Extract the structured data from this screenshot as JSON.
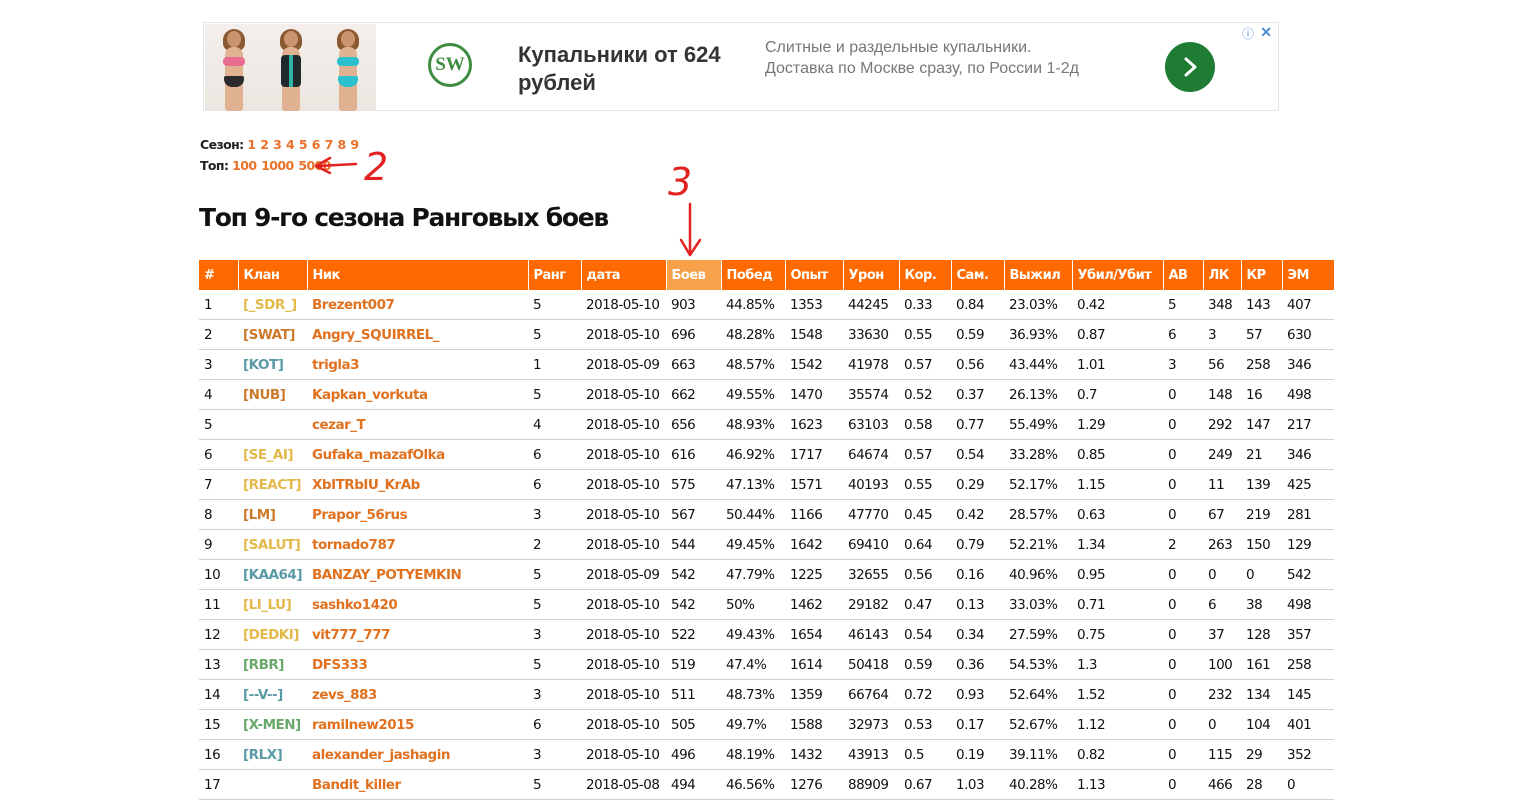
{
  "ad": {
    "title": "Купальники от 624 рублей",
    "description": "Слитные и раздельные купальники. Доставка по Москве сразу, по России 1-2д",
    "logo_text": "SW",
    "info_icon": "info-icon",
    "close_icon": "close-icon",
    "accent": "#1e7d32"
  },
  "nav": {
    "season_label": "Сезон:",
    "seasons": [
      "1",
      "2",
      "3",
      "4",
      "5",
      "6",
      "7",
      "8",
      "9"
    ],
    "top_label": "Топ:",
    "tops": [
      "100",
      "1000",
      "5000"
    ]
  },
  "annotations": [
    "2",
    "3"
  ],
  "page_title": "Топ 9-го сезона Ранговых боев",
  "table": {
    "header_color": "#ff6a00",
    "active_header_color": "#f7a24b",
    "active_column": "Боев",
    "columns": [
      "#",
      "Клан",
      "Ник",
      "Ранг",
      "дата",
      "Боев",
      "Побед",
      "Опыт",
      "Урон",
      "Кор.",
      "Сам.",
      "Выжил",
      "Убил/Убит",
      "АВ",
      "ЛК",
      "КР",
      "ЭМ"
    ],
    "rows": [
      {
        "num": "1",
        "clan": "[_SDR_]",
        "clan_color": "#e3b94a",
        "nick": "Brezent007",
        "rank": "5",
        "date": "2018-05-10",
        "battles": "903",
        "wins": "44.85%",
        "xp": "1353",
        "dmg": "44245",
        "kor": "0.33",
        "sam": "0.84",
        "surv": "23.03%",
        "kd": "0.42",
        "av": "5",
        "lk": "348",
        "kr": "143",
        "em": "407"
      },
      {
        "num": "2",
        "clan": "[SWAT]",
        "clan_color": "#cc7a2a",
        "nick": "Angry_SQUIRREL_",
        "rank": "5",
        "date": "2018-05-10",
        "battles": "696",
        "wins": "48.28%",
        "xp": "1548",
        "dmg": "33630",
        "kor": "0.55",
        "sam": "0.59",
        "surv": "36.93%",
        "kd": "0.87",
        "av": "6",
        "lk": "3",
        "kr": "57",
        "em": "630"
      },
      {
        "num": "3",
        "clan": "[KOT]",
        "clan_color": "#5a9aa6",
        "nick": "trigla3",
        "rank": "1",
        "date": "2018-05-09",
        "battles": "663",
        "wins": "48.57%",
        "xp": "1542",
        "dmg": "41978",
        "kor": "0.57",
        "sam": "0.56",
        "surv": "43.44%",
        "kd": "1.01",
        "av": "3",
        "lk": "56",
        "kr": "258",
        "em": "346"
      },
      {
        "num": "4",
        "clan": "[NUB]",
        "clan_color": "#cc7a2a",
        "nick": "Kapkan_vorkuta",
        "rank": "5",
        "date": "2018-05-10",
        "battles": "662",
        "wins": "49.55%",
        "xp": "1470",
        "dmg": "35574",
        "kor": "0.52",
        "sam": "0.37",
        "surv": "26.13%",
        "kd": "0.7",
        "av": "0",
        "lk": "148",
        "kr": "16",
        "em": "498"
      },
      {
        "num": "5",
        "clan": "",
        "clan_color": "#cc7a2a",
        "nick": "cezar_T",
        "rank": "4",
        "date": "2018-05-10",
        "battles": "656",
        "wins": "48.93%",
        "xp": "1623",
        "dmg": "63103",
        "kor": "0.58",
        "sam": "0.77",
        "surv": "55.49%",
        "kd": "1.29",
        "av": "0",
        "lk": "292",
        "kr": "147",
        "em": "217"
      },
      {
        "num": "6",
        "clan": "[SE_AI]",
        "clan_color": "#e3b94a",
        "nick": "Gufaka_mazafOlka",
        "rank": "6",
        "date": "2018-05-10",
        "battles": "616",
        "wins": "46.92%",
        "xp": "1717",
        "dmg": "64674",
        "kor": "0.57",
        "sam": "0.54",
        "surv": "33.28%",
        "kd": "0.85",
        "av": "0",
        "lk": "249",
        "kr": "21",
        "em": "346"
      },
      {
        "num": "7",
        "clan": "[REACT]",
        "clan_color": "#e3b94a",
        "nick": "XbITRbIU_KrAb",
        "rank": "6",
        "date": "2018-05-10",
        "battles": "575",
        "wins": "47.13%",
        "xp": "1571",
        "dmg": "40193",
        "kor": "0.55",
        "sam": "0.29",
        "surv": "52.17%",
        "kd": "1.15",
        "av": "0",
        "lk": "11",
        "kr": "139",
        "em": "425"
      },
      {
        "num": "8",
        "clan": "[LM]",
        "clan_color": "#cc7a2a",
        "nick": "Prapor_56rus",
        "rank": "3",
        "date": "2018-05-10",
        "battles": "567",
        "wins": "50.44%",
        "xp": "1166",
        "dmg": "47770",
        "kor": "0.45",
        "sam": "0.42",
        "surv": "28.57%",
        "kd": "0.63",
        "av": "0",
        "lk": "67",
        "kr": "219",
        "em": "281"
      },
      {
        "num": "9",
        "clan": "[SALUT]",
        "clan_color": "#e3b94a",
        "nick": "tornado787",
        "rank": "2",
        "date": "2018-05-10",
        "battles": "544",
        "wins": "49.45%",
        "xp": "1642",
        "dmg": "69410",
        "kor": "0.64",
        "sam": "0.79",
        "surv": "52.21%",
        "kd": "1.34",
        "av": "2",
        "lk": "263",
        "kr": "150",
        "em": "129"
      },
      {
        "num": "10",
        "clan": "[KAA64]",
        "clan_color": "#5a9aa6",
        "nick": "BANZAY_POTYEMKIN",
        "rank": "5",
        "date": "2018-05-09",
        "battles": "542",
        "wins": "47.79%",
        "xp": "1225",
        "dmg": "32655",
        "kor": "0.56",
        "sam": "0.16",
        "surv": "40.96%",
        "kd": "0.95",
        "av": "0",
        "lk": "0",
        "kr": "0",
        "em": "542"
      },
      {
        "num": "11",
        "clan": "[LI_LU]",
        "clan_color": "#e3b94a",
        "nick": "sashko1420",
        "rank": "5",
        "date": "2018-05-10",
        "battles": "542",
        "wins": "50%",
        "xp": "1462",
        "dmg": "29182",
        "kor": "0.47",
        "sam": "0.13",
        "surv": "33.03%",
        "kd": "0.71",
        "av": "0",
        "lk": "6",
        "kr": "38",
        "em": "498"
      },
      {
        "num": "12",
        "clan": "[DEDKI]",
        "clan_color": "#e3b94a",
        "nick": "vit777_777",
        "rank": "3",
        "date": "2018-05-10",
        "battles": "522",
        "wins": "49.43%",
        "xp": "1654",
        "dmg": "46143",
        "kor": "0.54",
        "sam": "0.34",
        "surv": "27.59%",
        "kd": "0.75",
        "av": "0",
        "lk": "37",
        "kr": "128",
        "em": "357"
      },
      {
        "num": "13",
        "clan": "[RBR]",
        "clan_color": "#6aa86a",
        "nick": "DFS333",
        "rank": "5",
        "date": "2018-05-10",
        "battles": "519",
        "wins": "47.4%",
        "xp": "1614",
        "dmg": "50418",
        "kor": "0.59",
        "sam": "0.36",
        "surv": "54.53%",
        "kd": "1.3",
        "av": "0",
        "lk": "100",
        "kr": "161",
        "em": "258"
      },
      {
        "num": "14",
        "clan": "[--V--]",
        "clan_color": "#5a9aa6",
        "nick": "zevs_883",
        "rank": "3",
        "date": "2018-05-10",
        "battles": "511",
        "wins": "48.73%",
        "xp": "1359",
        "dmg": "66764",
        "kor": "0.72",
        "sam": "0.93",
        "surv": "52.64%",
        "kd": "1.52",
        "av": "0",
        "lk": "232",
        "kr": "134",
        "em": "145"
      },
      {
        "num": "15",
        "clan": "[X-MEN]",
        "clan_color": "#6aa86a",
        "nick": "ramilnew2015",
        "rank": "6",
        "date": "2018-05-10",
        "battles": "505",
        "wins": "49.7%",
        "xp": "1588",
        "dmg": "32973",
        "kor": "0.53",
        "sam": "0.17",
        "surv": "52.67%",
        "kd": "1.12",
        "av": "0",
        "lk": "0",
        "kr": "104",
        "em": "401"
      },
      {
        "num": "16",
        "clan": "[RLX]",
        "clan_color": "#5a9aa6",
        "nick": "alexander_jashagin",
        "rank": "3",
        "date": "2018-05-10",
        "battles": "496",
        "wins": "48.19%",
        "xp": "1432",
        "dmg": "43913",
        "kor": "0.5",
        "sam": "0.19",
        "surv": "39.11%",
        "kd": "0.82",
        "av": "0",
        "lk": "115",
        "kr": "29",
        "em": "352"
      },
      {
        "num": "17",
        "clan": "",
        "clan_color": "#cc7a2a",
        "nick": "Bandit_killer",
        "rank": "5",
        "date": "2018-05-08",
        "battles": "494",
        "wins": "46.56%",
        "xp": "1276",
        "dmg": "88909",
        "kor": "0.67",
        "sam": "1.03",
        "surv": "40.28%",
        "kd": "1.13",
        "av": "0",
        "lk": "466",
        "kr": "28",
        "em": "0"
      }
    ]
  }
}
